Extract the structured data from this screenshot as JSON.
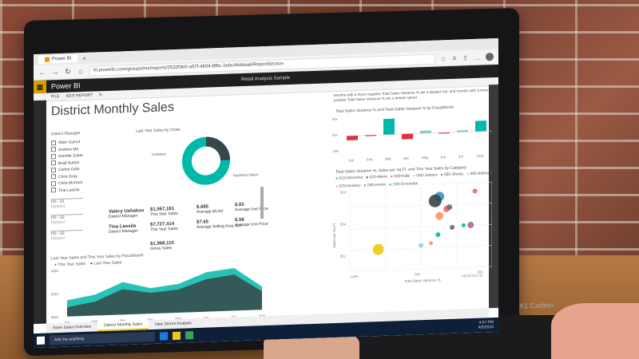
{
  "browser": {
    "tab_title": "Power BI",
    "url": "ht.powerbi.com/groups/me/reports/2532fdeb-a57f-4b04-8fbc-1ebc44d4ea6/ReportSection",
    "page_title": "Retail Analysis Sample"
  },
  "app": {
    "name": "Power BI",
    "menu_file": "FILE",
    "menu_edit": "EDIT REPORT"
  },
  "report": {
    "title": "District Monthly Sales",
    "slicer_title": "District Manager",
    "managers": [
      "Allan Guinot",
      "Andrew Ma",
      "Annelie Zubar",
      "Brad Sutton",
      "Carlos Grilo",
      "Chris Gray",
      "Chris McGurk",
      "Tina Lassila"
    ],
    "districts": [
      {
        "code": "FD - 01",
        "type": "Defunct"
      },
      {
        "code": "FD - 02",
        "type": "Defunct"
      },
      {
        "code": "FD - 03",
        "type": "Defunct"
      }
    ],
    "donut_title": "Last Year Sales by Chain",
    "donut_left_label": "Lindseys",
    "donut_right_label": "Fashions Direct",
    "donut_share": 0.25,
    "kpis": [
      {
        "label": "Valery Ushakov",
        "sub": "District Manager",
        "value": "$1,567,181",
        "caption": "This Year Sales",
        "v2": "$.685",
        "c2": "Average $/Unit",
        "v3": "$.65",
        "c3": "Average Unit Price"
      },
      {
        "label": "Tina Lassila",
        "sub": "District Manager",
        "value": "$7,727,414",
        "caption": "This Year Sales",
        "v2": "$7.65",
        "c2": "Average Selling Area Size",
        "v3": "$.58",
        "c3": "Average Unit Price"
      }
    ],
    "kpi_bottom": "$1,968,115",
    "kpi_bottom_caption": "Gross Sales",
    "area_title": "Last Year Sales and This Year Sales by FiscalMonth",
    "area_legend": [
      "This Year Sales",
      "Last Year Sales"
    ],
    "area_months": [
      "Jan",
      "Feb",
      "Mar",
      "Apr",
      "May",
      "Jun",
      "Jul",
      "Aug"
    ],
    "area_this_year": [
      0.35,
      0.45,
      0.7,
      0.55,
      0.62,
      0.85,
      0.92,
      0.5
    ],
    "area_last_year": [
      0.2,
      0.3,
      0.55,
      0.45,
      0.5,
      0.7,
      0.78,
      0.4
    ],
    "area_y_labels": [
      "$4M",
      "$2M",
      "$0M"
    ],
    "waterfall_desc": "Months with a more negative Total Sales Variance % are a deeper red, and months with a more positive Total Sales Variance % are a deeper green.",
    "waterfall_title": "Total Sales Variance % and Total Sales Variance % by FiscalMonth",
    "waterfall_months": [
      "Jan",
      "Feb",
      "Mar",
      "Apr",
      "May",
      "Jun",
      "Jul",
      "Aug"
    ],
    "waterfall_values": [
      -0.25,
      -0.05,
      0.9,
      -0.3,
      0.15,
      -0.05,
      0.1,
      0.6
    ],
    "waterfall_y": [
      "5%",
      "0%",
      "-5%"
    ],
    "scatter_title": "Total Sales Variance %, Sales per Sq Ft, and This Year Sales by Category",
    "scatter_categories": [
      "010-Womens",
      "020-Mens",
      "030-Kids",
      "040-Juniors",
      "050-Shoes",
      "060-Intimate",
      "070-Hosiery",
      "090-Home",
      "100-Groceries"
    ],
    "scatter_colors": [
      "#01b8aa",
      "#374649",
      "#fd625e",
      "#f2c80f",
      "#5f6b6d",
      "#8ad4eb",
      "#fe9666",
      "#a66999",
      "#3599b8"
    ],
    "scatter_ylabel": "Sales per Sq Ft",
    "scatter_xlabel": "Total Sales Variance %",
    "scatter_y": [
      "$16",
      "$14",
      "$12"
    ],
    "scatter_x": [
      "-10%",
      "-5%",
      "0%"
    ],
    "scatter_watermark": "obviEnce llc",
    "tabs": [
      "Store Sales Overview",
      "District Monthly Sales",
      "New Stores Analysis"
    ],
    "active_tab": 1
  },
  "taskbar": {
    "search_placeholder": "Ask me anything",
    "clock": "4:07 PM",
    "date": "4/5/2016"
  },
  "hardware_label": "X1 Carbon"
}
